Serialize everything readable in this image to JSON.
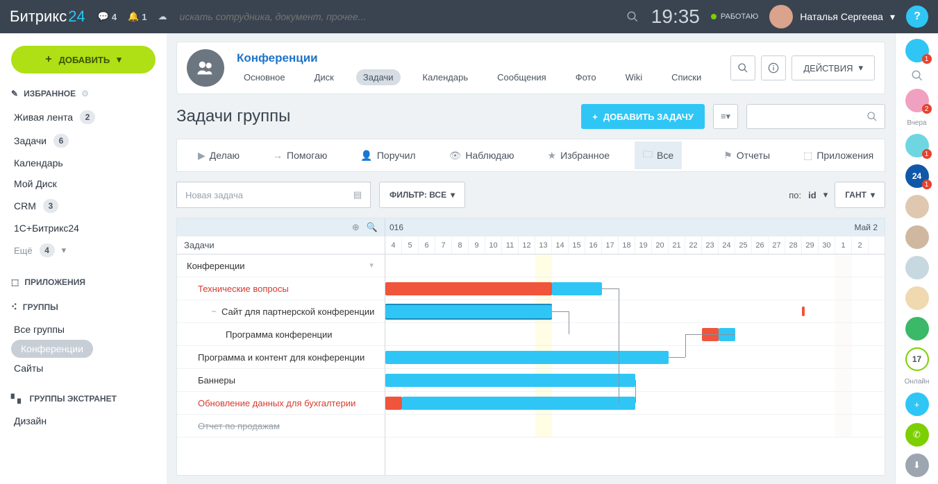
{
  "brand": {
    "a": "Битрикс",
    "b": "24"
  },
  "topbar": {
    "chat_count": "4",
    "notif_count": "1",
    "search_placeholder": "искать сотрудника, документ, прочее...",
    "time": "19:35",
    "work_status": "РАБОТАЮ",
    "user_name": "Наталья Сергеева",
    "help": "?"
  },
  "leftnav": {
    "add": "ДОБАВИТЬ",
    "fav_head": "ИЗБРАННОЕ",
    "fav": [
      {
        "label": "Живая лента",
        "badge": "2"
      },
      {
        "label": "Задачи",
        "badge": "6"
      },
      {
        "label": "Календарь"
      },
      {
        "label": "Мой Диск"
      },
      {
        "label": "CRM",
        "badge": "3"
      },
      {
        "label": "1С+Битрикс24"
      }
    ],
    "more": "Ещё",
    "more_badge": "4",
    "apps_head": "ПРИЛОЖЕНИЯ",
    "groups_head": "ГРУППЫ",
    "groups": [
      {
        "label": "Все группы"
      },
      {
        "label": "Конференции",
        "active": true
      },
      {
        "label": "Сайты"
      }
    ],
    "extranet_head": "ГРУППЫ ЭКСТРАНЕТ",
    "extranet": [
      {
        "label": "Дизайн"
      }
    ]
  },
  "group": {
    "title": "Конференции",
    "tabs": [
      "Основное",
      "Диск",
      "Задачи",
      "Календарь",
      "Сообщения",
      "Фото",
      "Wiki",
      "Списки"
    ],
    "active_tab": 2,
    "actions_label": "ДЕЙСТВИЯ"
  },
  "page": {
    "title": "Задачи группы",
    "add_task": "ДОБАВИТЬ ЗАДАЧУ"
  },
  "task_tabs": [
    "Делаю",
    "Помогаю",
    "Поручил",
    "Наблюдаю",
    "Избранное",
    "Все",
    "Отчеты",
    "Приложения"
  ],
  "task_tabs_active": 5,
  "tools": {
    "newtask_ph": "Новая задача",
    "filter": "ФИЛЬТР: ВСЕ",
    "by": "по:",
    "id": "id",
    "view": "ГАНТ"
  },
  "gantt": {
    "left_title": "Задачи",
    "month1": "016",
    "month2": "Май 2",
    "days": [
      4,
      5,
      6,
      7,
      8,
      9,
      10,
      11,
      12,
      13,
      14,
      15,
      16,
      17,
      18,
      19,
      20,
      21,
      22,
      23,
      24,
      25,
      26,
      27,
      28,
      29,
      30,
      1,
      2
    ],
    "today_idx": 9,
    "weekend_idx": [
      27
    ],
    "rows": [
      {
        "label": "Конференции",
        "cls": "folder",
        "caret": true
      },
      {
        "label": "Технические вопросы",
        "cls": "red indent1"
      },
      {
        "label": "Сайт для партнерской конференции",
        "cls": "indent2",
        "exp": "–"
      },
      {
        "label": "Программа конференции",
        "cls": "indent3"
      },
      {
        "label": "Программа и контент для конференции",
        "cls": "indent1"
      },
      {
        "label": "Баннеры",
        "cls": "indent1"
      },
      {
        "label": "Обновление данных для бухгалтерии",
        "cls": "red indent1"
      },
      {
        "label": "Отчет по продажам",
        "cls": "gray indent1"
      }
    ]
  },
  "rail": {
    "label_yesterday": "Вчера",
    "online_count": "17",
    "online_label": "Онлайн"
  }
}
